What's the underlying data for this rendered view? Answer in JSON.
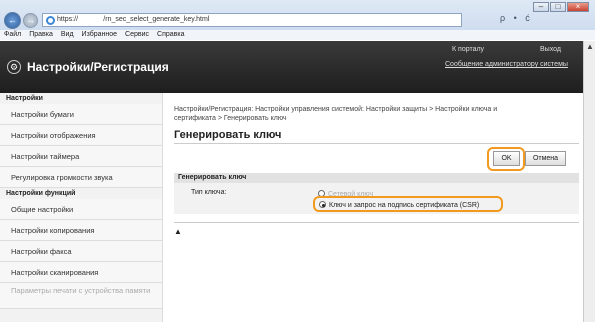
{
  "browser": {
    "address": "https://             /rn_sec_select_generate_key.html",
    "search_refresh": "ρ • ć",
    "menu": [
      "Файл",
      "Правка",
      "Вид",
      "Избранное",
      "Сервис",
      "Справка"
    ],
    "win_min": "–",
    "win_max": "□",
    "win_close": "×",
    "back": "←",
    "fwd": "→"
  },
  "header": {
    "title": "Настройки/Регистрация",
    "to_portal": "К порталу",
    "logout": "Выход",
    "admin_message": "Сообщение администратору системы"
  },
  "sidebar": {
    "settings_heading": "Настройки",
    "settings_items": [
      "Настройки бумаги",
      "Настройки отображения",
      "Настройки таймера",
      "Регулировка громкости звука"
    ],
    "functions_heading": "Настройки функций",
    "function_items": [
      "Общие настройки",
      "Настройки копирования",
      "Настройки факса",
      "Настройки сканирования"
    ],
    "disabled_item": "Параметры печати с устройства памяти"
  },
  "main": {
    "breadcrumb": "Настройки/Регистрация: Настройки управления системой: Настройки защиты > Настройки ключа и сертификата > Генерировать ключ",
    "page_title": "Генерировать ключ",
    "ok_label": "OK",
    "cancel_label": "Отмена",
    "panel_title": "Генерировать ключ",
    "key_type_label": "Тип ключа:",
    "option_network": "Сетевой ключ",
    "option_csr": "Ключ и запрос на подпись сертификата (CSR)",
    "selected_option": "option_csr",
    "top_anchor": "▲"
  },
  "colors": {
    "highlight": "#f29a1f",
    "header_bg": "#2a2a2a"
  }
}
